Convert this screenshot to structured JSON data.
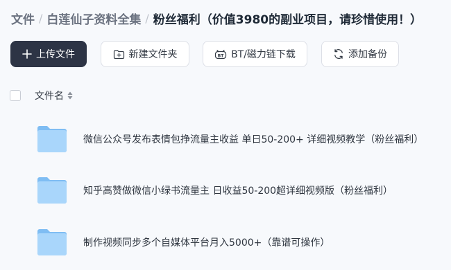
{
  "breadcrumb": {
    "root": "文件",
    "parent": "白莲仙子资料全集",
    "current": "粉丝福利（价值3980的副业项目，请珍惜使用！）",
    "separator": "/"
  },
  "toolbar": {
    "upload_label": "上传文件",
    "new_folder_label": "新建文件夹",
    "bt_label": "BT/磁力链下载",
    "backup_label": "添加备份"
  },
  "list_header": {
    "column_name": "文件名"
  },
  "files": [
    {
      "name": "微信公众号发布表情包挣流量主收益 单日50-200+ 详细视频教学（粉丝福利）",
      "icon": "folder-icon"
    },
    {
      "name": "知乎高赞做微信小绿书流量主 日收益50-200超详细视频版（粉丝福利）",
      "icon": "folder-icon"
    },
    {
      "name": "制作视频同步多个自媒体平台月入5000+（靠谱可操作）",
      "icon": "folder-icon"
    }
  ],
  "colors": {
    "primary_button": "#2d3445",
    "background": "#f7f9fc",
    "folder_light": "#a9d6fb",
    "folder_dark": "#7fbdf3"
  }
}
